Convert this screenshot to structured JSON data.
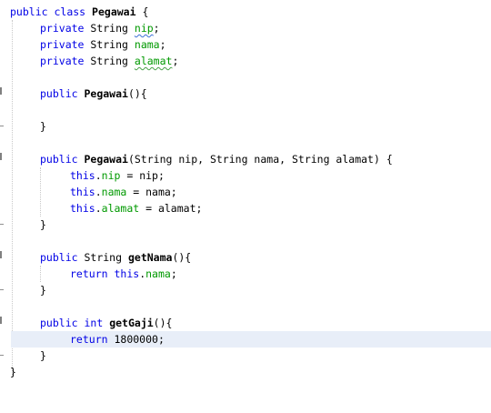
{
  "editor": {
    "language": "java",
    "colors": {
      "keyword": "#0000e6",
      "field": "#009900",
      "current_line": "#e8eef8"
    },
    "lines": {
      "l1": {
        "kw1": "public",
        "kw2": "class",
        "name": "Pegawai",
        "brace": "{"
      },
      "l2": {
        "kw": "private",
        "type": "String",
        "field": "nip",
        "semi": ";"
      },
      "l3": {
        "kw": "private",
        "type": "String",
        "field": "nama",
        "semi": ";"
      },
      "l4": {
        "kw": "private",
        "type": "String",
        "field": "alamat",
        "semi": ";"
      },
      "l6": {
        "kw": "public",
        "name": "Pegawai",
        "rest": "(){"
      },
      "l8": {
        "text": "}"
      },
      "l10": {
        "kw": "public",
        "name": "Pegawai",
        "rest": "(String nip, String nama, String alamat) {"
      },
      "l11": {
        "this": "this",
        "dot": ".",
        "field": "nip",
        "rest": " = nip;"
      },
      "l12": {
        "this": "this",
        "dot": ".",
        "field": "nama",
        "rest": " = nama;"
      },
      "l13": {
        "this": "this",
        "dot": ".",
        "field": "alamat",
        "rest": " = alamat;"
      },
      "l14": {
        "text": "}"
      },
      "l16": {
        "kw": "public",
        "type": "String",
        "name": "getNama",
        "rest": "(){"
      },
      "l17": {
        "kw1": "return",
        "kw2": "this",
        "dot": ".",
        "field": "nama",
        "semi": ";"
      },
      "l18": {
        "text": "}"
      },
      "l20": {
        "kw1": "public",
        "kw2": "int",
        "name": "getGaji",
        "rest": "(){"
      },
      "l21": {
        "kw": "return",
        "value": "1800000;"
      },
      "l22": {
        "text": "}"
      },
      "l23": {
        "text": "}"
      }
    }
  }
}
